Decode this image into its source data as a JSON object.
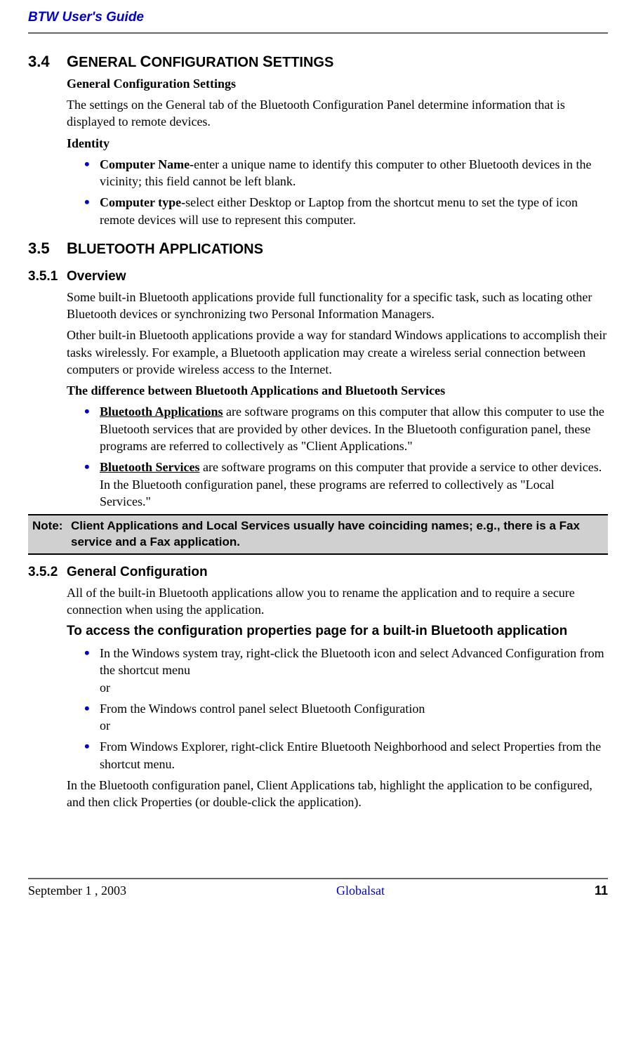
{
  "header": "BTW User's Guide",
  "s34": {
    "num": "3.4",
    "title_cap1": "G",
    "title_low1": "ENERAL ",
    "title_cap2": "C",
    "title_low2": "ONFIGURATION ",
    "title_cap3": "S",
    "title_low3": "ETTINGS",
    "sub1": "General Configuration Settings",
    "p1": "The settings on the General tab of the Bluetooth Configuration Panel determine information that is displayed to remote devices.",
    "identity": "Identity",
    "li1_b": "Computer Name-",
    "li1_t": "enter a unique name to identify this computer to other Bluetooth devices in the vicinity; this field cannot be left blank.",
    "li2_b": "Computer type-",
    "li2_t": "select either Desktop or Laptop from the shortcut menu to set the type of icon remote devices will use to represent this computer."
  },
  "s35": {
    "num": "3.5",
    "title_cap1": "B",
    "title_low1": "LUETOOTH ",
    "title_cap2": "A",
    "title_low2": "PPLICATIONS"
  },
  "s351": {
    "num": "3.5.1",
    "title": "Overview",
    "p1": "Some built-in Bluetooth applications provide full functionality for a specific task, such as locating other Bluetooth devices or synchronizing two Personal Information Managers.",
    "p2": "Other built-in Bluetooth applications provide a way for standard Windows applications to accomplish their tasks wirelessly. For example, a Bluetooth application may create a wireless serial connection between computers or provide wireless access to the Internet.",
    "diff": "The difference between Bluetooth Applications and Bluetooth Services",
    "li1_b": "Bluetooth Applications",
    "li1_t": " are software programs on this computer that allow this computer to use the Bluetooth services that are provided by other devices. In the Bluetooth configuration panel, these programs are referred to collectively as \"Client Applications.\"",
    "li2_b": "Bluetooth Services",
    "li2_t": " are software programs on this computer that provide a service to other devices. In the Bluetooth configuration panel, these programs are referred to collectively as \"Local Services.\""
  },
  "note": {
    "label": "Note:",
    "text": "Client Applications and Local Services usually have coinciding names; e.g., there is a Fax service and a Fax application."
  },
  "s352": {
    "num": "3.5.2",
    "title": "General Configuration",
    "p1": "All of the built-in Bluetooth applications allow you to rename the application and to require a secure connection when using the application.",
    "access": "To access the configuration properties page for a built-in Bluetooth application",
    "li1": "In the Windows system tray, right-click the Bluetooth icon and select Advanced Configuration from the shortcut menu",
    "or": "or",
    "li2": "From the Windows control panel select Bluetooth Configuration",
    "li3": "From Windows Explorer, right-click Entire Bluetooth Neighborhood and select Properties from the shortcut menu.",
    "p2": "In the Bluetooth configuration panel, Client Applications tab, highlight the application to be configured, and then click Properties (or double-click the application)."
  },
  "footer": {
    "left": "September 1 , 2003",
    "center": "Globalsat",
    "right": "11"
  }
}
